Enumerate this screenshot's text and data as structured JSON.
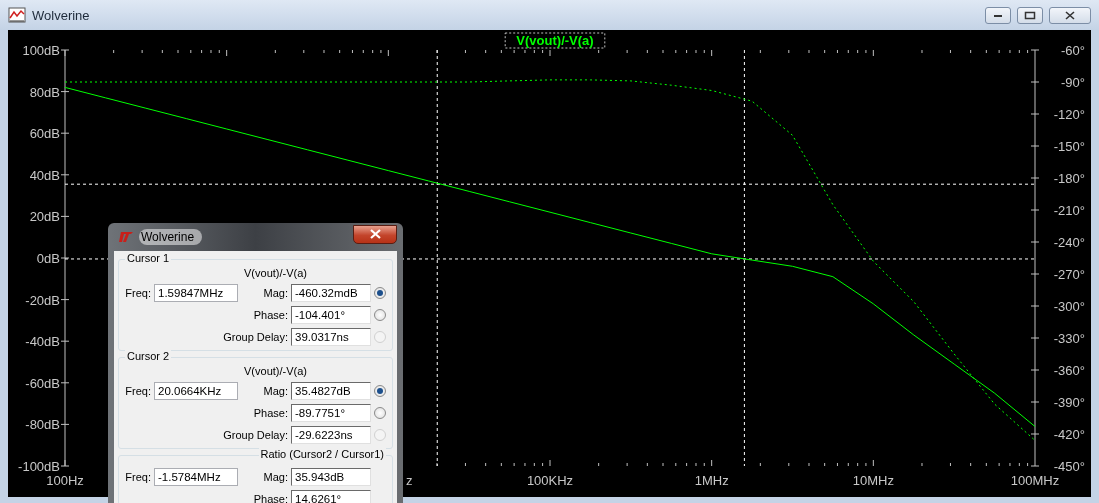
{
  "window": {
    "title": "Wolverine"
  },
  "plot": {
    "chart_data": {
      "type": "line",
      "title": "V(vout)/-V(a)",
      "categories": [
        "100Hz",
        null,
        null,
        null,
        null,
        null,
        null,
        null,
        null,
        null,
        null,
        null,
        "100KHz",
        null,
        null,
        null,
        "1MHz",
        null,
        null,
        null,
        "10MHz",
        null,
        null,
        null,
        "100MHz"
      ],
      "series": [
        {
          "color": "#00ff00",
          "line_style": "solid",
          "values": [
            82,
            77,
            72,
            67,
            62,
            57,
            52,
            47,
            42,
            37,
            32,
            27,
            22,
            17,
            12,
            7,
            2,
            -1,
            -4,
            -9,
            -22,
            -37,
            -51,
            -65,
            -81
          ]
        },
        {
          "color": "#00ff00",
          "axis": "y2",
          "line_style": "dashed",
          "values": [
            -90,
            -90,
            -90,
            -90,
            -90,
            -90,
            -90,
            -90,
            -90,
            -90,
            -90,
            -89,
            -88,
            -88,
            -89,
            -93,
            -98,
            -108,
            -140,
            -205,
            -258,
            -296,
            -345,
            -392,
            -426
          ]
        }
      ],
      "ylim": [
        -100,
        100
      ],
      "y2lim": [
        -450,
        -60
      ],
      "yticks": [
        {
          "value": 100,
          "label": "100dB"
        },
        {
          "value": 80,
          "label": "80dB"
        },
        {
          "value": 60,
          "label": "60dB"
        },
        {
          "value": 40,
          "label": "40dB"
        },
        {
          "value": 20,
          "label": "20dB"
        },
        {
          "value": 0,
          "label": "0dB"
        },
        {
          "value": -20,
          "label": "-20dB"
        },
        {
          "value": -40,
          "label": "-40dB"
        },
        {
          "value": -60,
          "label": "-60dB"
        },
        {
          "value": -80,
          "label": "-80dB"
        },
        {
          "value": -100,
          "label": "-100dB"
        }
      ],
      "y2ticks": [
        {
          "value": -60,
          "label": "-60°"
        },
        {
          "value": -90,
          "label": "-90°"
        },
        {
          "value": -120,
          "label": "-120°"
        },
        {
          "value": -150,
          "label": "-150°"
        },
        {
          "value": -180,
          "label": "-180°"
        },
        {
          "value": -210,
          "label": "-210°"
        },
        {
          "value": -240,
          "label": "-240°"
        },
        {
          "value": -270,
          "label": "-270°"
        },
        {
          "value": -300,
          "label": "-300°"
        },
        {
          "value": -330,
          "label": "-330°"
        },
        {
          "value": -360,
          "label": "-360°"
        },
        {
          "value": -390,
          "label": "-390°"
        },
        {
          "value": -420,
          "label": "-420°"
        },
        {
          "value": -450,
          "label": "-450°"
        }
      ],
      "ref_lines": [
        {
          "axis": "y",
          "value": -0.46
        },
        {
          "axis": "y",
          "value": 35.48
        }
      ]
    },
    "partial_tick_label": "z"
  },
  "dialog": {
    "title": "Wolverine",
    "groups": [
      {
        "title": "Cursor 1",
        "trace": "V(vout)/-V(a)",
        "freq_label": "Freq:",
        "freq": "1.59847MHz",
        "rows": [
          {
            "label": "Mag:",
            "value": "-460.32mdB",
            "selected": true,
            "disabled": false
          },
          {
            "label": "Phase:",
            "value": "-104.401°",
            "selected": false,
            "disabled": false
          },
          {
            "label": "Group Delay:",
            "value": "39.0317ns",
            "selected": false,
            "disabled": true
          }
        ]
      },
      {
        "title": "Cursor 2",
        "trace": "V(vout)/-V(a)",
        "freq_label": "Freq:",
        "freq": "20.0664KHz",
        "rows": [
          {
            "label": "Mag:",
            "value": "35.4827dB",
            "selected": true,
            "disabled": false
          },
          {
            "label": "Phase:",
            "value": "-89.7751°",
            "selected": false,
            "disabled": false
          },
          {
            "label": "Group Delay:",
            "value": "-29.6223ns",
            "selected": false,
            "disabled": true
          }
        ]
      },
      {
        "title": "Ratio (Cursor2 / Cursor1)",
        "freq_label": "Freq:",
        "freq": "-1.5784MHz",
        "rows": [
          {
            "label": "Mag:",
            "value": "35.943dB"
          },
          {
            "label": "Phase:",
            "value": "14.6261°"
          }
        ]
      }
    ]
  }
}
